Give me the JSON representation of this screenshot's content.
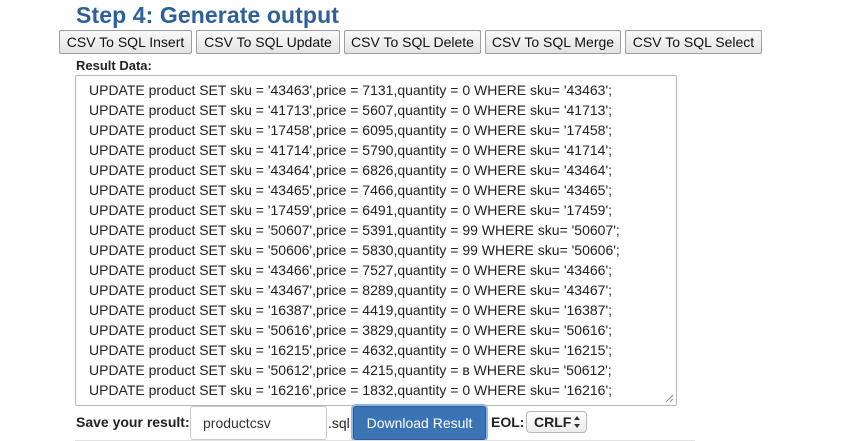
{
  "title": "Step 4: Generate output",
  "buttons": [
    {
      "label": "CSV To SQL Insert"
    },
    {
      "label": "CSV To SQL Update"
    },
    {
      "label": "CSV To SQL Delete"
    },
    {
      "label": "CSV To SQL Merge"
    },
    {
      "label": "CSV To SQL Select"
    }
  ],
  "result_label": "Result Data:",
  "result_lines": [
    "UPDATE product SET sku = '43463',price = 7131,quantity = 0 WHERE sku= '43463';",
    "UPDATE product SET sku = '41713',price = 5607,quantity = 0 WHERE sku= '41713';",
    "UPDATE product SET sku = '17458',price = 6095,quantity = 0 WHERE sku= '17458';",
    "UPDATE product SET sku = '41714',price = 5790,quantity = 0 WHERE sku= '41714';",
    "UPDATE product SET sku = '43464',price = 6826,quantity = 0 WHERE sku= '43464';",
    "UPDATE product SET sku = '43465',price = 7466,quantity = 0 WHERE sku= '43465';",
    "UPDATE product SET sku = '17459',price = 6491,quantity = 0 WHERE sku= '17459';",
    "UPDATE product SET sku = '50607',price = 5391,quantity = 99 WHERE sku= '50607';",
    "UPDATE product SET sku = '50606',price = 5830,quantity = 99 WHERE sku= '50606';",
    "UPDATE product SET sku = '43466',price = 7527,quantity = 0 WHERE sku= '43466';",
    "UPDATE product SET sku = '43467',price = 8289,quantity = 0 WHERE sku= '43467';",
    "UPDATE product SET sku = '16387',price = 4419,quantity = 0 WHERE sku= '16387';",
    "UPDATE product SET sku = '50616',price = 3829,quantity = 0 WHERE sku= '50616';",
    "UPDATE product SET sku = '16215',price = 4632,quantity = 0 WHERE sku= '16215';",
    "UPDATE product SET sku = '50612',price = 4215,quantity = в WHERE sku= '50612';",
    "UPDATE product SET sku = '16216',price = 1832,quantity = 0 WHERE sku= '16216';"
  ],
  "save": {
    "label": "Save your result:",
    "filename": "productcsv",
    "extension": ".sql",
    "download_label": "Download Result"
  },
  "eol": {
    "label": "EOL:",
    "selected": "CRLF"
  },
  "colors": {
    "title": "#2d5f9a",
    "download_button": "#3a74b4"
  }
}
